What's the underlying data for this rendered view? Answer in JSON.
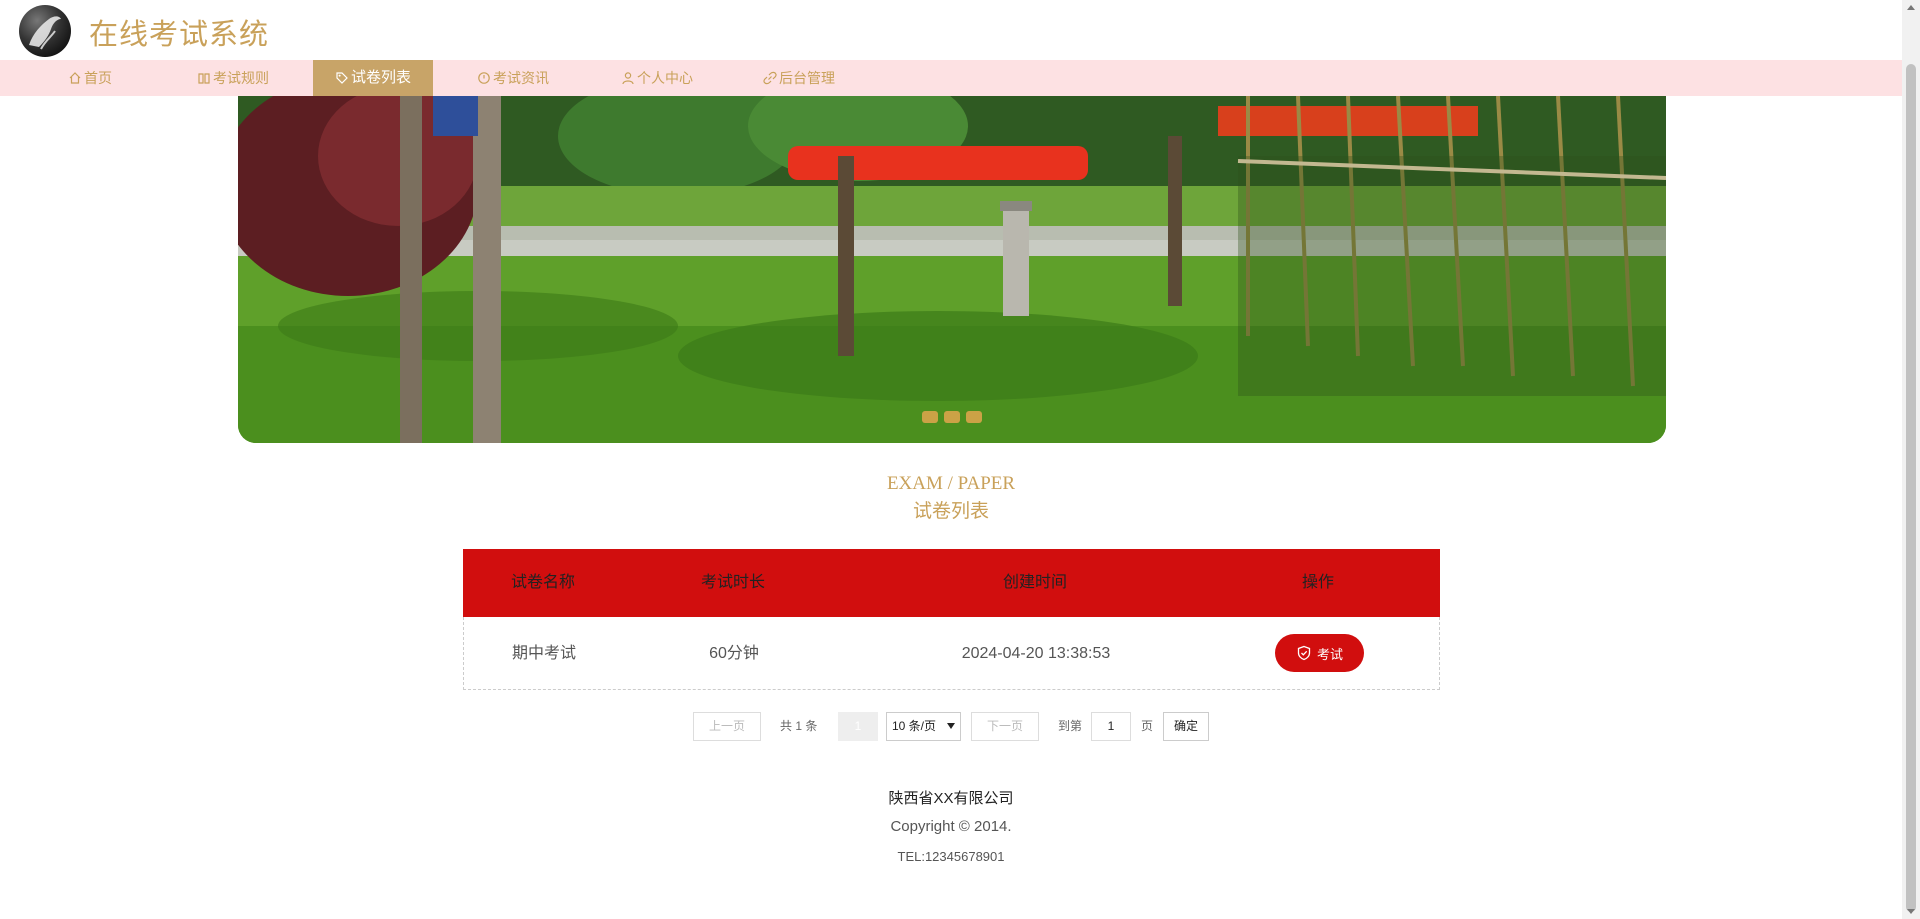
{
  "header": {
    "title": "在线考试系统"
  },
  "nav": {
    "items": [
      {
        "label": "首页",
        "icon": "home-icon"
      },
      {
        "label": "考试规则",
        "icon": "book-icon"
      },
      {
        "label": "试卷列表",
        "icon": "tag-icon",
        "active": true
      },
      {
        "label": "考试资讯",
        "icon": "clock-icon"
      },
      {
        "label": "个人中心",
        "icon": "user-icon"
      },
      {
        "label": "后台管理",
        "icon": "link-icon"
      }
    ]
  },
  "section": {
    "title_en": "EXAM / PAPER",
    "title_cn": "试卷列表"
  },
  "table": {
    "columns": [
      "试卷名称",
      "考试时长",
      "创建时间",
      "操作"
    ],
    "rows": [
      {
        "name": "期中考试",
        "duration": "60分钟",
        "created": "2024-04-20 13:38:53",
        "action": "考试"
      }
    ]
  },
  "pagination": {
    "prev": "上一页",
    "total": "共 1 条",
    "current": "1",
    "page_size": "10 条/页",
    "next": "下一页",
    "goto_label": "到第",
    "goto_value": "1",
    "page_unit": "页",
    "confirm": "确定"
  },
  "footer": {
    "company": "陕西省XX有限公司",
    "copyright": "Copyright © 2014.",
    "tel": "TEL:12345678901"
  },
  "colors": {
    "accent_gold": "#c9a15a",
    "nav_bg": "#fde1e3",
    "nav_active": "#c8a468",
    "primary_red": "#d10e0e"
  }
}
